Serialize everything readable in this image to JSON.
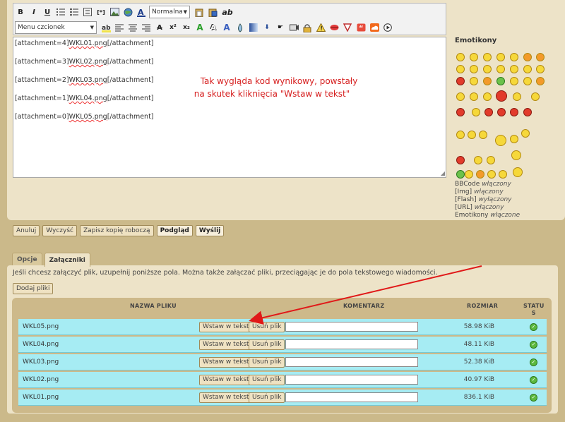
{
  "toolbar": {
    "row1": [
      "B",
      "I",
      "U",
      "list-numbered",
      "list-bullet",
      "list-item",
      "[*]",
      "image",
      "link",
      "A"
    ],
    "font_size_select": "Normalna",
    "row1_end": [
      "paste",
      "paste-word",
      "ab"
    ],
    "font_select": "Menu czcionek",
    "row2": [
      "highlight",
      "align-left",
      "align-center",
      "align-right",
      "A-strike",
      "x2-sup",
      "x2-sub",
      "A-outline",
      "A-shadow",
      "A-glow",
      "drop",
      "gradient",
      "flash",
      "pointer",
      "video",
      "lock",
      "warning",
      "lips",
      "triangle",
      "quote",
      "soundcloud",
      "play"
    ]
  },
  "editor": {
    "lines": [
      {
        "pre": "[attachment=4]",
        "file": "WKL01.png",
        "post": "[/attachment]"
      },
      {
        "pre": "[attachment=3]",
        "file": "WKL02.png",
        "post": "[/attachment]"
      },
      {
        "pre": "[attachment=2]",
        "file": "WKL03.png",
        "post": "[/attachment]"
      },
      {
        "pre": "[attachment=1]",
        "file": "WKL04.png",
        "post": "[/attachment]"
      },
      {
        "pre": "[attachment=0]",
        "file": "WKL05.png",
        "post": "[/attachment]"
      }
    ]
  },
  "annotation": {
    "line1": "Tak wygląda kod wynikowy, powstały",
    "line2": "na skutek kliknięcia \"Wstaw w tekst\""
  },
  "emoticons": {
    "title": "Emotikony"
  },
  "bbinfo": [
    {
      "label": "BBCode",
      "status": "włączony"
    },
    {
      "label": "[Img]",
      "status": "włączony"
    },
    {
      "label": "[Flash]",
      "status": "wyłączony"
    },
    {
      "label": "[URL]",
      "status": "włączony"
    },
    {
      "label": "Emotikony",
      "status": "włączone"
    }
  ],
  "actions": {
    "cancel": "Anuluj",
    "clear": "Wyczyść",
    "save_draft": "Zapisz kopię roboczą",
    "preview": "Podgląd",
    "send": "Wyślij"
  },
  "tabs": {
    "options": "Opcje",
    "attachments": "Załączniki"
  },
  "hint": "Jeśli chcesz załączyć plik, uzupełnij poniższe pola. Można także załączać pliki, przeciągając je do pola tekstowego wiadomości.",
  "add_files": "Dodaj pliki",
  "table": {
    "col_name": "NAZWA PLIKU",
    "col_comment": "KOMENTARZ",
    "col_size": "ROZMIAR",
    "col_status_1": "STATU",
    "col_status_2": "S",
    "insert_label": "Wstaw w tekst",
    "remove_label": "Usuń plik",
    "rows": [
      {
        "name": "WKL05.png",
        "size": "58.98 KiB"
      },
      {
        "name": "WKL04.png",
        "size": "48.11 KiB"
      },
      {
        "name": "WKL03.png",
        "size": "52.38 KiB"
      },
      {
        "name": "WKL02.png",
        "size": "40.97 KiB"
      },
      {
        "name": "WKL01.png",
        "size": "836.1 KiB"
      }
    ]
  },
  "colors": {
    "row_bg": "#a6ecf3",
    "panel_bg": "#ede3c8",
    "page_bg": "#cbb98a",
    "annotation": "#d61f1f",
    "status_ok": "#5bb83e"
  }
}
